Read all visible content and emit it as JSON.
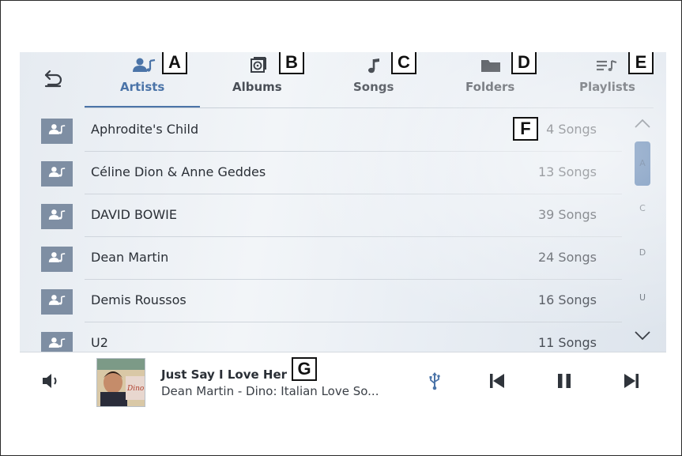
{
  "tabs": [
    {
      "label": "Artists",
      "icon": "artist-icon",
      "callout": "A",
      "active": true
    },
    {
      "label": "Albums",
      "icon": "album-icon",
      "callout": "B",
      "active": false
    },
    {
      "label": "Songs",
      "icon": "music-note-icon",
      "callout": "C",
      "active": false
    },
    {
      "label": "Folders",
      "icon": "folder-icon",
      "callout": "D",
      "active": false
    },
    {
      "label": "Playlists",
      "icon": "playlist-icon",
      "callout": "E",
      "active": false
    }
  ],
  "list": {
    "callout": "F",
    "rows": [
      {
        "name": "Aphrodite's Child",
        "count": "4 Songs"
      },
      {
        "name": "Céline Dion & Anne Geddes",
        "count": "13 Songs"
      },
      {
        "name": "DAVID BOWIE",
        "count": "39 Songs"
      },
      {
        "name": "Dean Martin",
        "count": "24 Songs"
      },
      {
        "name": "Demis Roussos",
        "count": "16 Songs"
      },
      {
        "name": "U2",
        "count": "11 Songs"
      }
    ]
  },
  "index": {
    "letters": [
      "A",
      "C",
      "D",
      "U"
    ],
    "active": "A"
  },
  "player": {
    "title": "Just Say I Love Her",
    "subtitle": "Dean Martin - Dino: Italian Love So...",
    "callout": "G",
    "source_icon": "usb-icon",
    "album_text": "Dino"
  },
  "colors": {
    "accent": "#4b74a8",
    "row_icon_bg": "#7e8ea3",
    "text": "#2a2f36"
  }
}
